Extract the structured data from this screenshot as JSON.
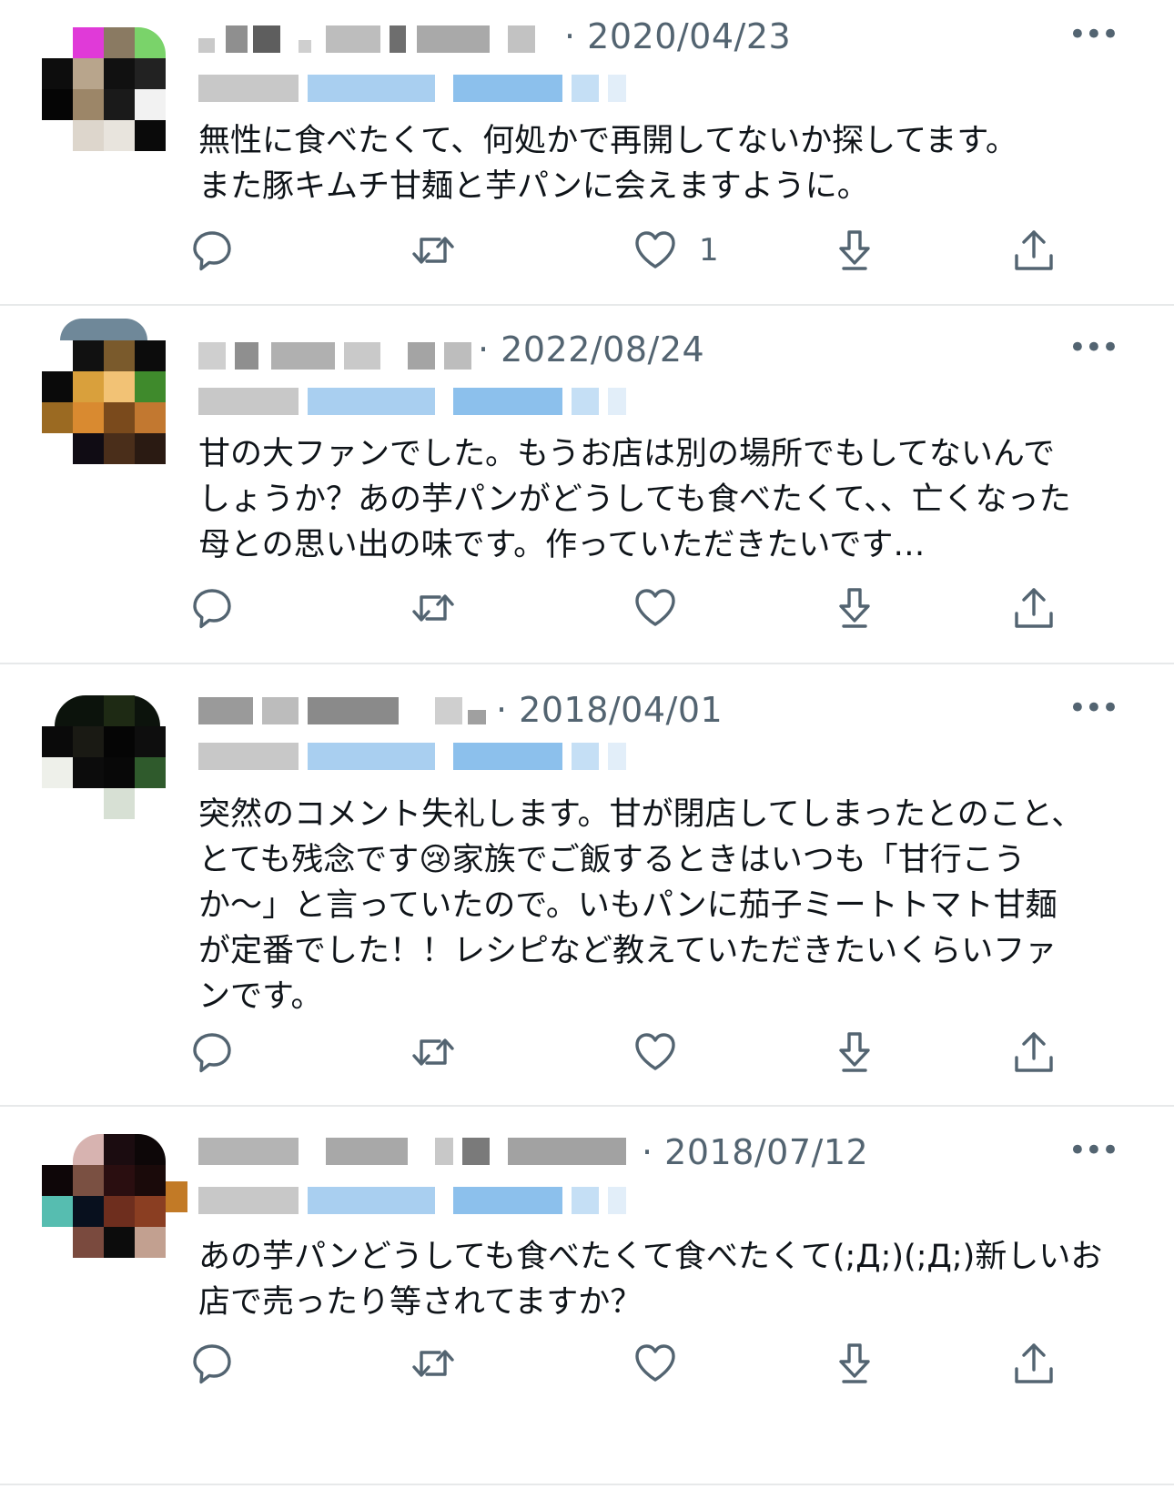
{
  "tweets": [
    {
      "date": "· 2020/04/23",
      "text": "無性に食べたくて、何処かで再開してないか探してます。\nまた豚キムチ甘麺と芋パンに会えますように。",
      "like_count": "1",
      "more_icon": "more-icon"
    },
    {
      "date": "· 2022/08/24",
      "text": "甘の大ファンでした。もうお店は別の場所でもしてないんでしょうか？あの芋パンがどうしても食べたくて、、亡くなった母との思い出の味です。作っていただきたいです…",
      "like_count": "",
      "more_icon": "more-icon"
    },
    {
      "date": "· 2018/04/01",
      "text": "突然のコメント失礼します。甘が閉店してしまったとのこと、とても残念です😢家族でご飯するときはいつも「甘行こうか〜」と言っていたので。いもパンに茄子ミートトマト甘麺が定番でした！！レシピなど教えていただきたいくらいファンです。",
      "like_count": "",
      "more_icon": "more-icon"
    },
    {
      "date": "· 2018/07/12",
      "text": "あの芋パンどうしても食べたくて食べたくて(;Д;)(;Д;)新しいお店で売ったり等されてますか？",
      "like_count": "",
      "more_icon": "more-icon"
    }
  ],
  "icons": {
    "reply": "reply-icon",
    "retweet": "retweet-icon",
    "like": "heart-icon",
    "download": "download-icon",
    "share": "share-icon"
  },
  "colors": {
    "text": "#0f1419",
    "muted": "#536471",
    "divider": "#e7e9ea"
  }
}
